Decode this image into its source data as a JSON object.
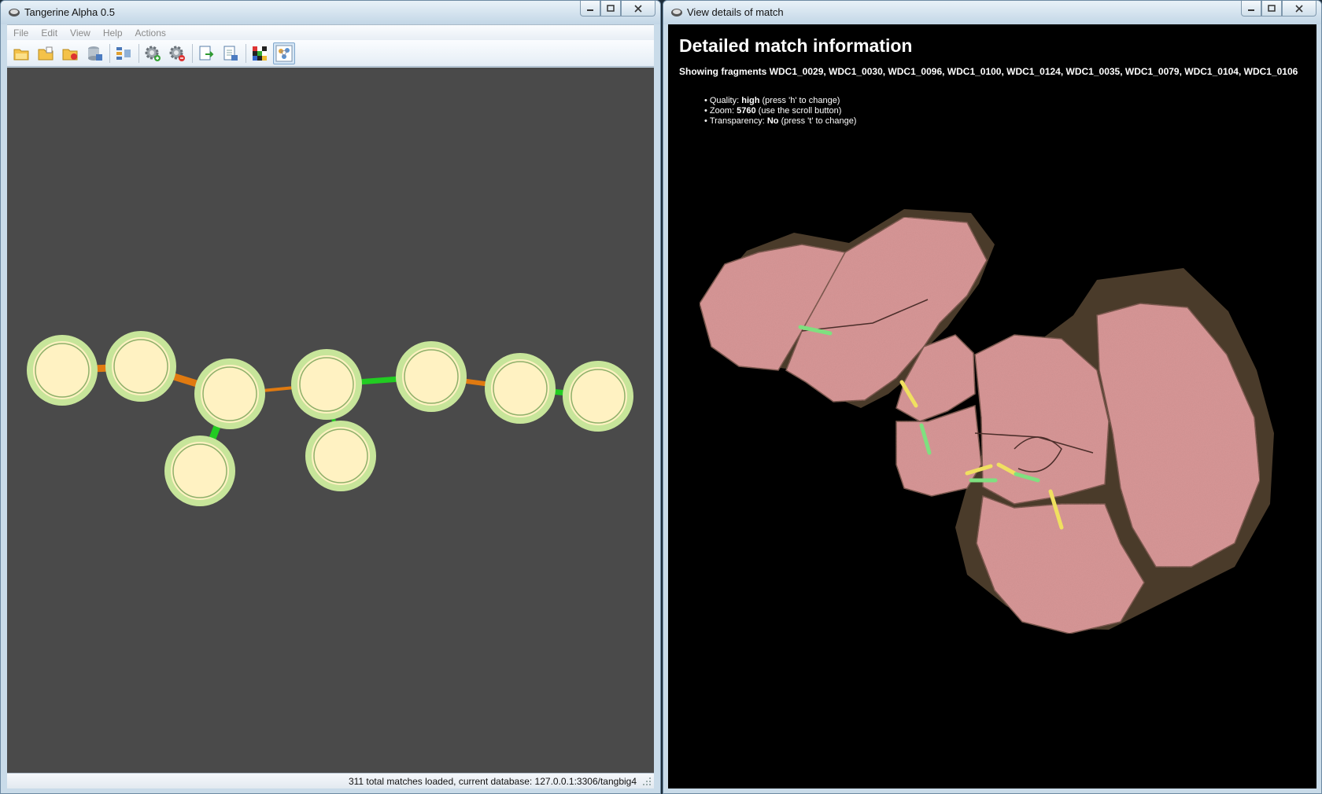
{
  "left_window": {
    "title": "Tangerine Alpha 0.5",
    "menu": [
      "File",
      "Edit",
      "View",
      "Help",
      "Actions"
    ],
    "toolbar_icons": [
      "open-folder-icon",
      "open-folder-icon",
      "open-folder-icon",
      "database-icon",
      "layout-icon",
      "add-gear-icon",
      "remove-gear-icon",
      "export-icon",
      "document-icon",
      "palette-icon",
      "graph-view-icon"
    ],
    "status_text": "311 total matches loaded, current database: 127.0.0.1:3306/tangbig4",
    "colors": {
      "canvas": "#4a4a4a",
      "node_fill": "#fff2c2",
      "node_ring": "#c7e59a",
      "edge_green": "#22cc22",
      "edge_orange": "#e07a10"
    }
  },
  "right_window": {
    "title": "View details of match",
    "heading": "Detailed match information",
    "fragments_label": "Showing fragments WDC1_0029, WDC1_0030, WDC1_0096, WDC1_0100, WDC1_0124, WDC1_0035, WDC1_0079, WDC1_0104, WDC1_0106",
    "quality_label": "Quality:",
    "quality_value": "high",
    "quality_hint": "(press 'h' to change)",
    "zoom_label": "Zoom:",
    "zoom_value": "5760",
    "zoom_hint": "(use the scroll button)",
    "transparency_label": "Transparency:",
    "transparency_value": "No",
    "transparency_hint": "(press 't' to change)",
    "colors": {
      "background": "#000000",
      "fragment": "#d99595",
      "match_green": "#7fe07f",
      "match_yellow": "#f0e060"
    }
  }
}
